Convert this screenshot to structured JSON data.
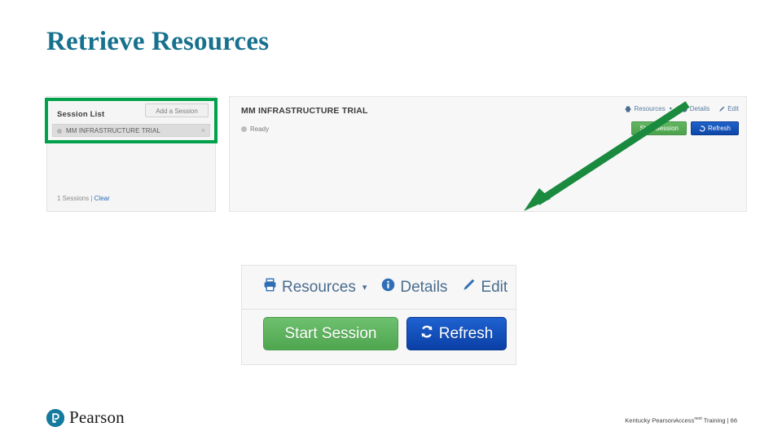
{
  "slide": {
    "title": "Retrieve Resources",
    "title_color": "#17718e"
  },
  "screenshot": {
    "session_panel": {
      "header_title": "Session List",
      "add_button_label": "Add a Session",
      "item_label": "MM INFRASTRUCTURE TRIAL",
      "item_close_glyph": "×",
      "footer_count": "1 Sessions",
      "footer_separator": " | ",
      "footer_clear_label": "Clear"
    },
    "detail_panel": {
      "title": "MM INFRASTRUCTURE TRIAL",
      "status_label": "Ready",
      "toolbar": [
        {
          "label": "Resources",
          "icon": "printer-icon",
          "caret": "▾"
        },
        {
          "label": "Details",
          "icon": "info-circle-icon"
        },
        {
          "label": "Edit",
          "icon": "pencil-icon"
        }
      ],
      "buttons": [
        {
          "label": "Start Session",
          "color": "#4da24d"
        },
        {
          "label": "Refresh",
          "icon": "refresh-icon",
          "color": "#0d46a8"
        }
      ]
    }
  },
  "callout": {
    "toolbar": [
      {
        "label": "Resources",
        "icon": "printer-icon",
        "caret": "▾"
      },
      {
        "label": "Details",
        "icon": "info-circle-icon"
      },
      {
        "label": "Edit",
        "icon": "pencil-icon"
      }
    ],
    "buttons": [
      {
        "label": "Start Session",
        "color": "#4fa64f"
      },
      {
        "label": "Refresh",
        "icon": "refresh-icon",
        "color": "#0a3fa6"
      }
    ]
  },
  "annotations": {
    "highlight_color": "#00a14b",
    "highlight_session_list": "Session List",
    "highlight_resources": "Resources",
    "arrow": "points from Resources toolbar down-left to callout"
  },
  "footer": {
    "logo_text": "Pearson",
    "note_main": "Kentucky PearsonAccess",
    "note_sup": "next",
    "note_tail": " Training | 66"
  }
}
